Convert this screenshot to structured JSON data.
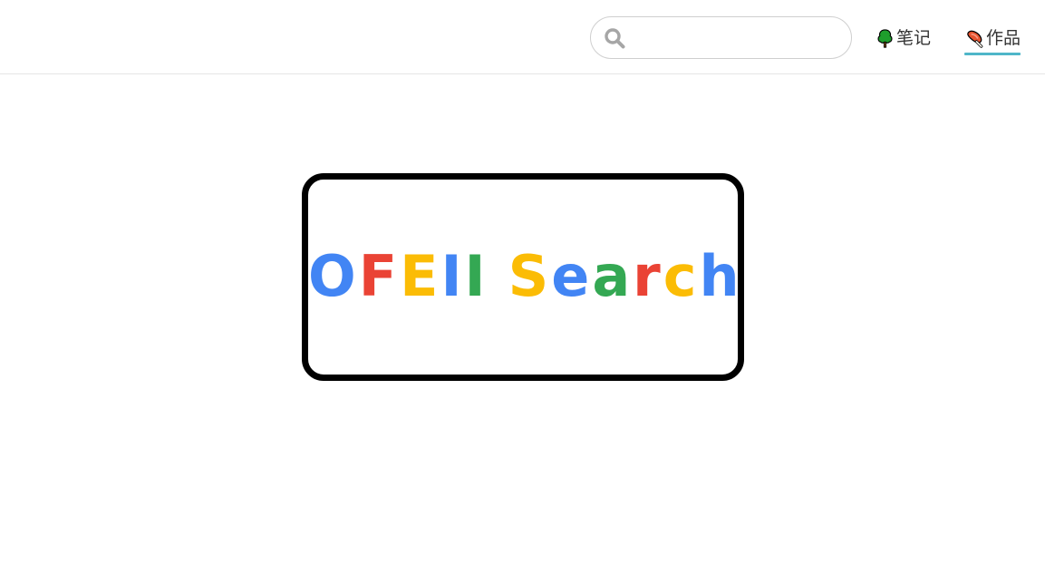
{
  "header": {
    "search": {
      "icon": "search-icon",
      "value": "",
      "placeholder": ""
    },
    "nav": [
      {
        "label": "笔记",
        "icon": "tree-icon",
        "active": false
      },
      {
        "label": "作品",
        "icon": "meat-icon",
        "active": true
      }
    ],
    "active_underline_color": "#4fb6c9"
  },
  "logo": {
    "letters": [
      {
        "char": "O",
        "color": "#4285f4"
      },
      {
        "char": "F",
        "color": "#ea4335"
      },
      {
        "char": "E",
        "color": "#fbbc05"
      },
      {
        "char": "I",
        "color": "#4285f4"
      },
      {
        "char": "I",
        "color": "#34a853"
      },
      {
        "char": " ",
        "color": "#000000"
      },
      {
        "char": "S",
        "color": "#fbbc05"
      },
      {
        "char": "e",
        "color": "#4285f4"
      },
      {
        "char": "a",
        "color": "#34a853"
      },
      {
        "char": "r",
        "color": "#ea4335"
      },
      {
        "char": "c",
        "color": "#fbbc05"
      },
      {
        "char": "h",
        "color": "#4285f4"
      }
    ]
  }
}
